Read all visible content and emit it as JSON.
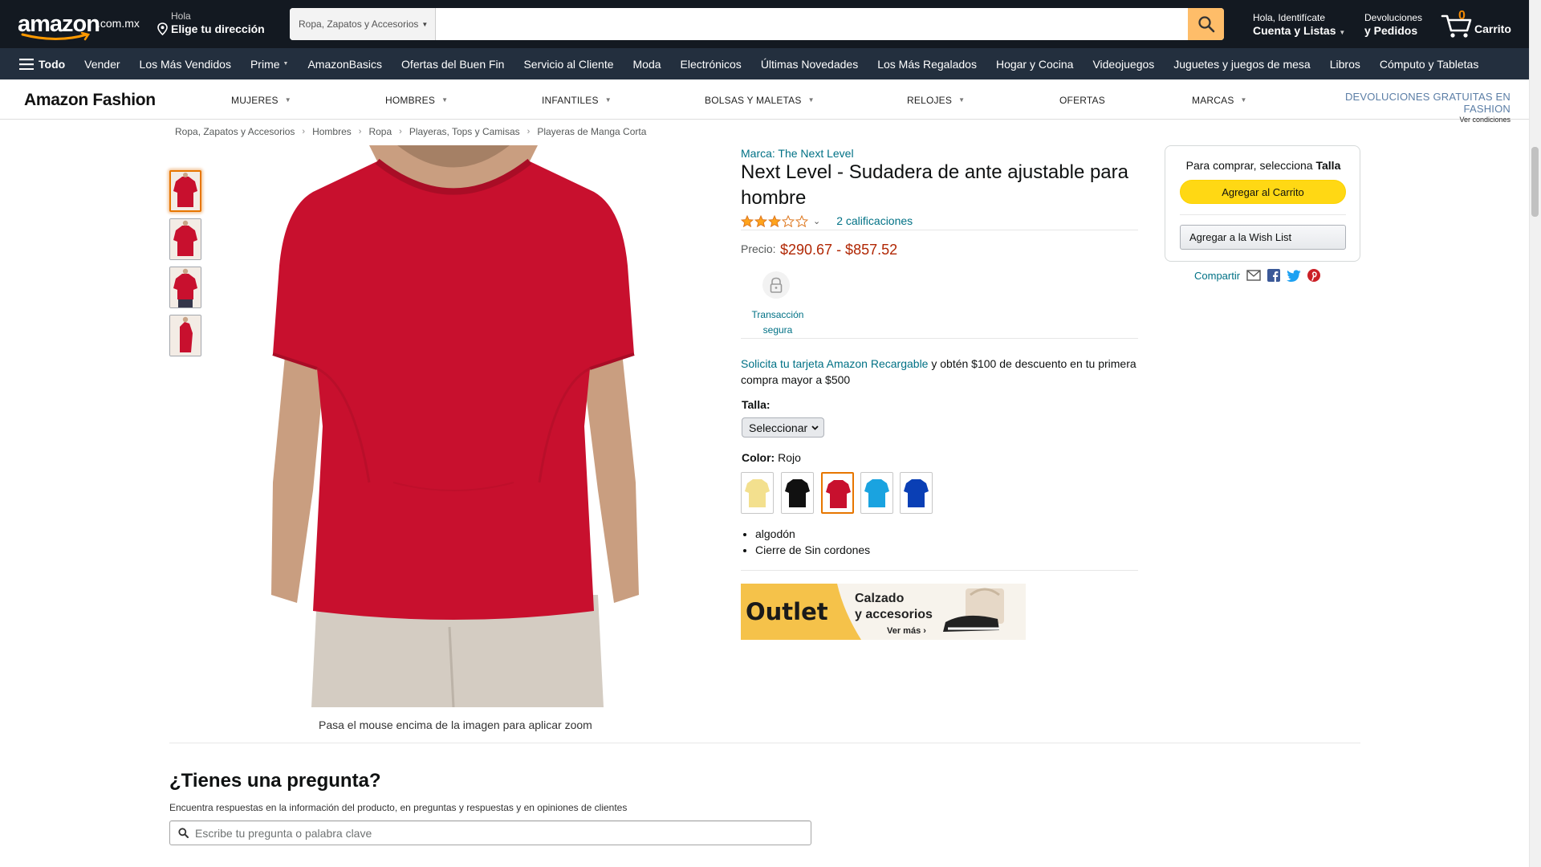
{
  "header": {
    "logo_text": "amazon",
    "logo_tld": ".com.mx",
    "deliver_line1": "Hola",
    "deliver_line2": "Elige tu dirección",
    "search_dept": "Ropa, Zapatos y Accesorios",
    "search_placeholder": "",
    "account_line1": "Hola, Identifícate",
    "account_line2": "Cuenta y Listas",
    "returns_line1": "Devoluciones",
    "returns_line2": "y Pedidos",
    "cart_count": "0",
    "cart_label": "Carrito"
  },
  "subnav": {
    "all_label": "Todo",
    "items": [
      "Vender",
      "Los Más Vendidos",
      "Prime",
      "AmazonBasics",
      "Ofertas del Buen Fin",
      "Servicio al Cliente",
      "Moda",
      "Electrónicos",
      "Últimas Novedades",
      "Los Más Regalados",
      "Hogar y Cocina",
      "Videojuegos",
      "Juguetes y juegos de mesa",
      "Libros",
      "Cómputo y Tabletas"
    ]
  },
  "fashion": {
    "logo": "Amazon Fashion",
    "items": [
      "MUJERES",
      "HOMBRES",
      "INFANTILES",
      "BOLSAS Y MALETAS",
      "RELOJES",
      "OFERTAS",
      "MARCAS"
    ],
    "returns_line1": "DEVOLUCIONES GRATUITAS EN FASHION",
    "returns_line2": "Ver condiciones"
  },
  "breadcrumb": [
    "Ropa, Zapatos y Accesorios",
    "Hombres",
    "Ropa",
    "Playeras, Tops y Camisas",
    "Playeras de Manga Corta"
  ],
  "gallery": {
    "zoom_hint": "Pasa el mouse encima de la imagen para aplicar zoom"
  },
  "product": {
    "brand": "Marca: The Next Level",
    "title": "Next Level - Sudadera de ante ajustable para hombre",
    "rating": 3,
    "rating_count": "2 calificaciones",
    "price_label": "Precio:",
    "price": "$290.67 - $857.52",
    "secure_label": "Transacción segura",
    "promo_link": "Solicita tu tarjeta Amazon Recargable",
    "promo_rest": " y obtén $100 de descuento en tu primera compra mayor a $500",
    "size_label": "Talla:",
    "size_value": "Seleccionar",
    "color_label": "Color:",
    "color_value": "Rojo",
    "colors": [
      "#f3e08e",
      "#111111",
      "#c8102e",
      "#1aa3e0",
      "#0a3fb5"
    ],
    "bullets": [
      "algodón",
      "Cierre de Sin cordones"
    ],
    "shirt_color": "#c8102e"
  },
  "ad": {
    "outlet": "Outlet",
    "line1": "Calzado",
    "line2": "y accesorios",
    "cta": "Ver más ›"
  },
  "buybox": {
    "prompt": "Para comprar, selecciona ",
    "prompt_bold": "Talla",
    "cart_button": "Agregar al Carrito",
    "wish_button": "Agregar a la Wish List",
    "share_label": "Compartir"
  },
  "qa": {
    "title": "¿Tienes una pregunta?",
    "subtitle": "Encuentra respuestas en la información del producto, en preguntas y respuestas y en opiniones de clientes",
    "placeholder": "Escribe tu pregunta o palabra clave"
  }
}
